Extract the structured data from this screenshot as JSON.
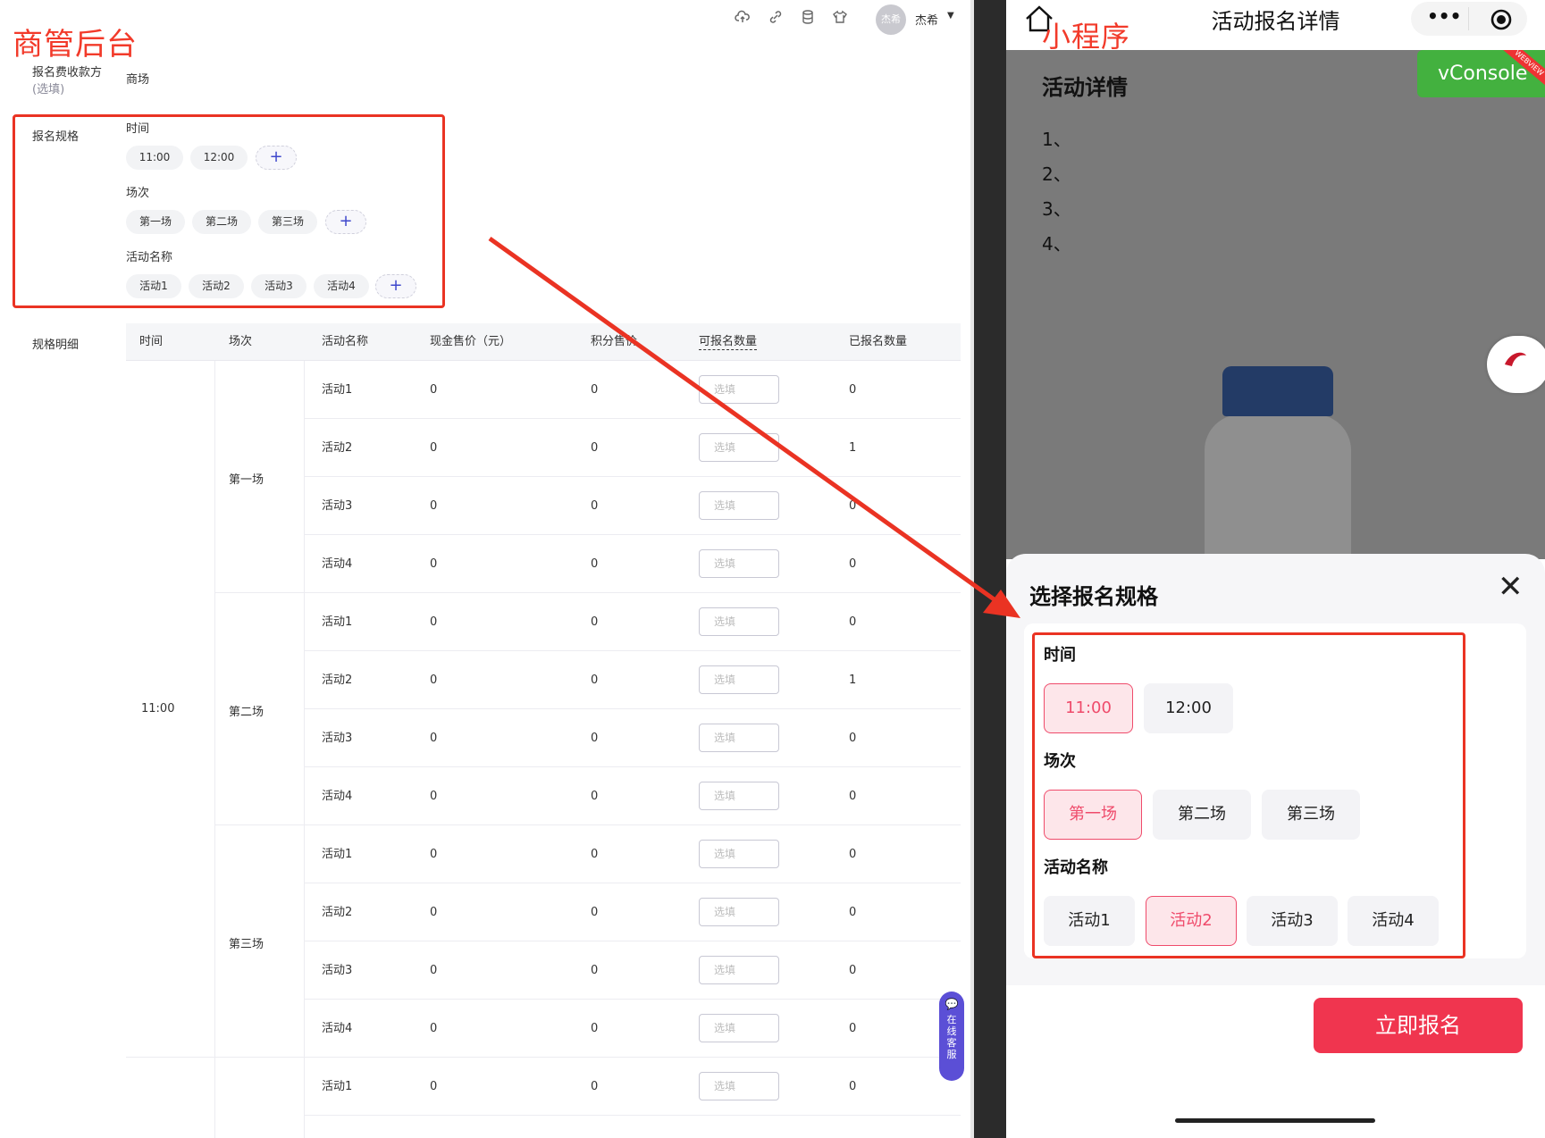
{
  "annotations": {
    "admin_label": "商管后台",
    "mini_label": "小程序"
  },
  "admin": {
    "topbar": {
      "icons": [
        "cloud-upload-icon",
        "link-icon",
        "database-icon",
        "shirt-icon"
      ],
      "avatar_text": "杰希",
      "username": "杰希"
    },
    "payee": {
      "label": "报名费收款方",
      "optional": "(选填)",
      "value": "商场"
    },
    "spec": {
      "label": "报名规格",
      "groups": [
        {
          "title": "时间",
          "chips": [
            "11:00",
            "12:00"
          ]
        },
        {
          "title": "场次",
          "chips": [
            "第一场",
            "第二场",
            "第三场"
          ]
        },
        {
          "title": "活动名称",
          "chips": [
            "活动1",
            "活动2",
            "活动3",
            "活动4"
          ]
        }
      ],
      "add_symbol": "+"
    },
    "detail": {
      "label": "规格明细",
      "columns": [
        "时间",
        "场次",
        "活动名称",
        "现金售价（元）",
        "积分售价",
        "可报名数量",
        "已报名数量"
      ],
      "input_placeholder": "选填",
      "time_merged": "11:00",
      "sessions": [
        {
          "name": "第一场",
          "rows": [
            {
              "activity": "活动1",
              "cash": "0",
              "points": "0",
              "signed": "0"
            },
            {
              "activity": "活动2",
              "cash": "0",
              "points": "0",
              "signed": "1"
            },
            {
              "activity": "活动3",
              "cash": "0",
              "points": "0",
              "signed": "0"
            },
            {
              "activity": "活动4",
              "cash": "0",
              "points": "0",
              "signed": "0"
            }
          ]
        },
        {
          "name": "第二场",
          "rows": [
            {
              "activity": "活动1",
              "cash": "0",
              "points": "0",
              "signed": "0"
            },
            {
              "activity": "活动2",
              "cash": "0",
              "points": "0",
              "signed": "1"
            },
            {
              "activity": "活动3",
              "cash": "0",
              "points": "0",
              "signed": "0"
            },
            {
              "activity": "活动4",
              "cash": "0",
              "points": "0",
              "signed": "0"
            }
          ]
        },
        {
          "name": "第三场",
          "rows": [
            {
              "activity": "活动1",
              "cash": "0",
              "points": "0",
              "signed": "0"
            },
            {
              "activity": "活动2",
              "cash": "0",
              "points": "0",
              "signed": "0"
            },
            {
              "activity": "活动3",
              "cash": "0",
              "points": "0",
              "signed": "0"
            },
            {
              "activity": "活动4",
              "cash": "0",
              "points": "0",
              "signed": "0"
            }
          ]
        },
        {
          "name": "",
          "rows": [
            {
              "activity": "活动1",
              "cash": "0",
              "points": "0",
              "signed": "0"
            }
          ]
        }
      ]
    },
    "service_pill": "在线客服"
  },
  "mini": {
    "nav_title": "活动报名详情",
    "more_icon": "•••",
    "vconsole": "vConsole",
    "ribbon": "WEBVIEW",
    "content_title": "活动详情",
    "list": [
      "1、",
      "2、",
      "3、",
      "4、"
    ],
    "sheet": {
      "title": "选择报名规格",
      "close_icon": "✕",
      "groups": [
        {
          "title": "时间",
          "options": [
            "11:00",
            "12:00"
          ],
          "selected": 0
        },
        {
          "title": "场次",
          "options": [
            "第一场",
            "第二场",
            "第三场"
          ],
          "selected": 0
        },
        {
          "title": "活动名称",
          "options": [
            "活动1",
            "活动2",
            "活动3",
            "活动4"
          ],
          "selected": 1
        }
      ],
      "cta": "立即报名"
    },
    "colors": {
      "accent": "#f0354f",
      "annotation": "#ea3323",
      "vconsole": "#43b13f"
    }
  }
}
